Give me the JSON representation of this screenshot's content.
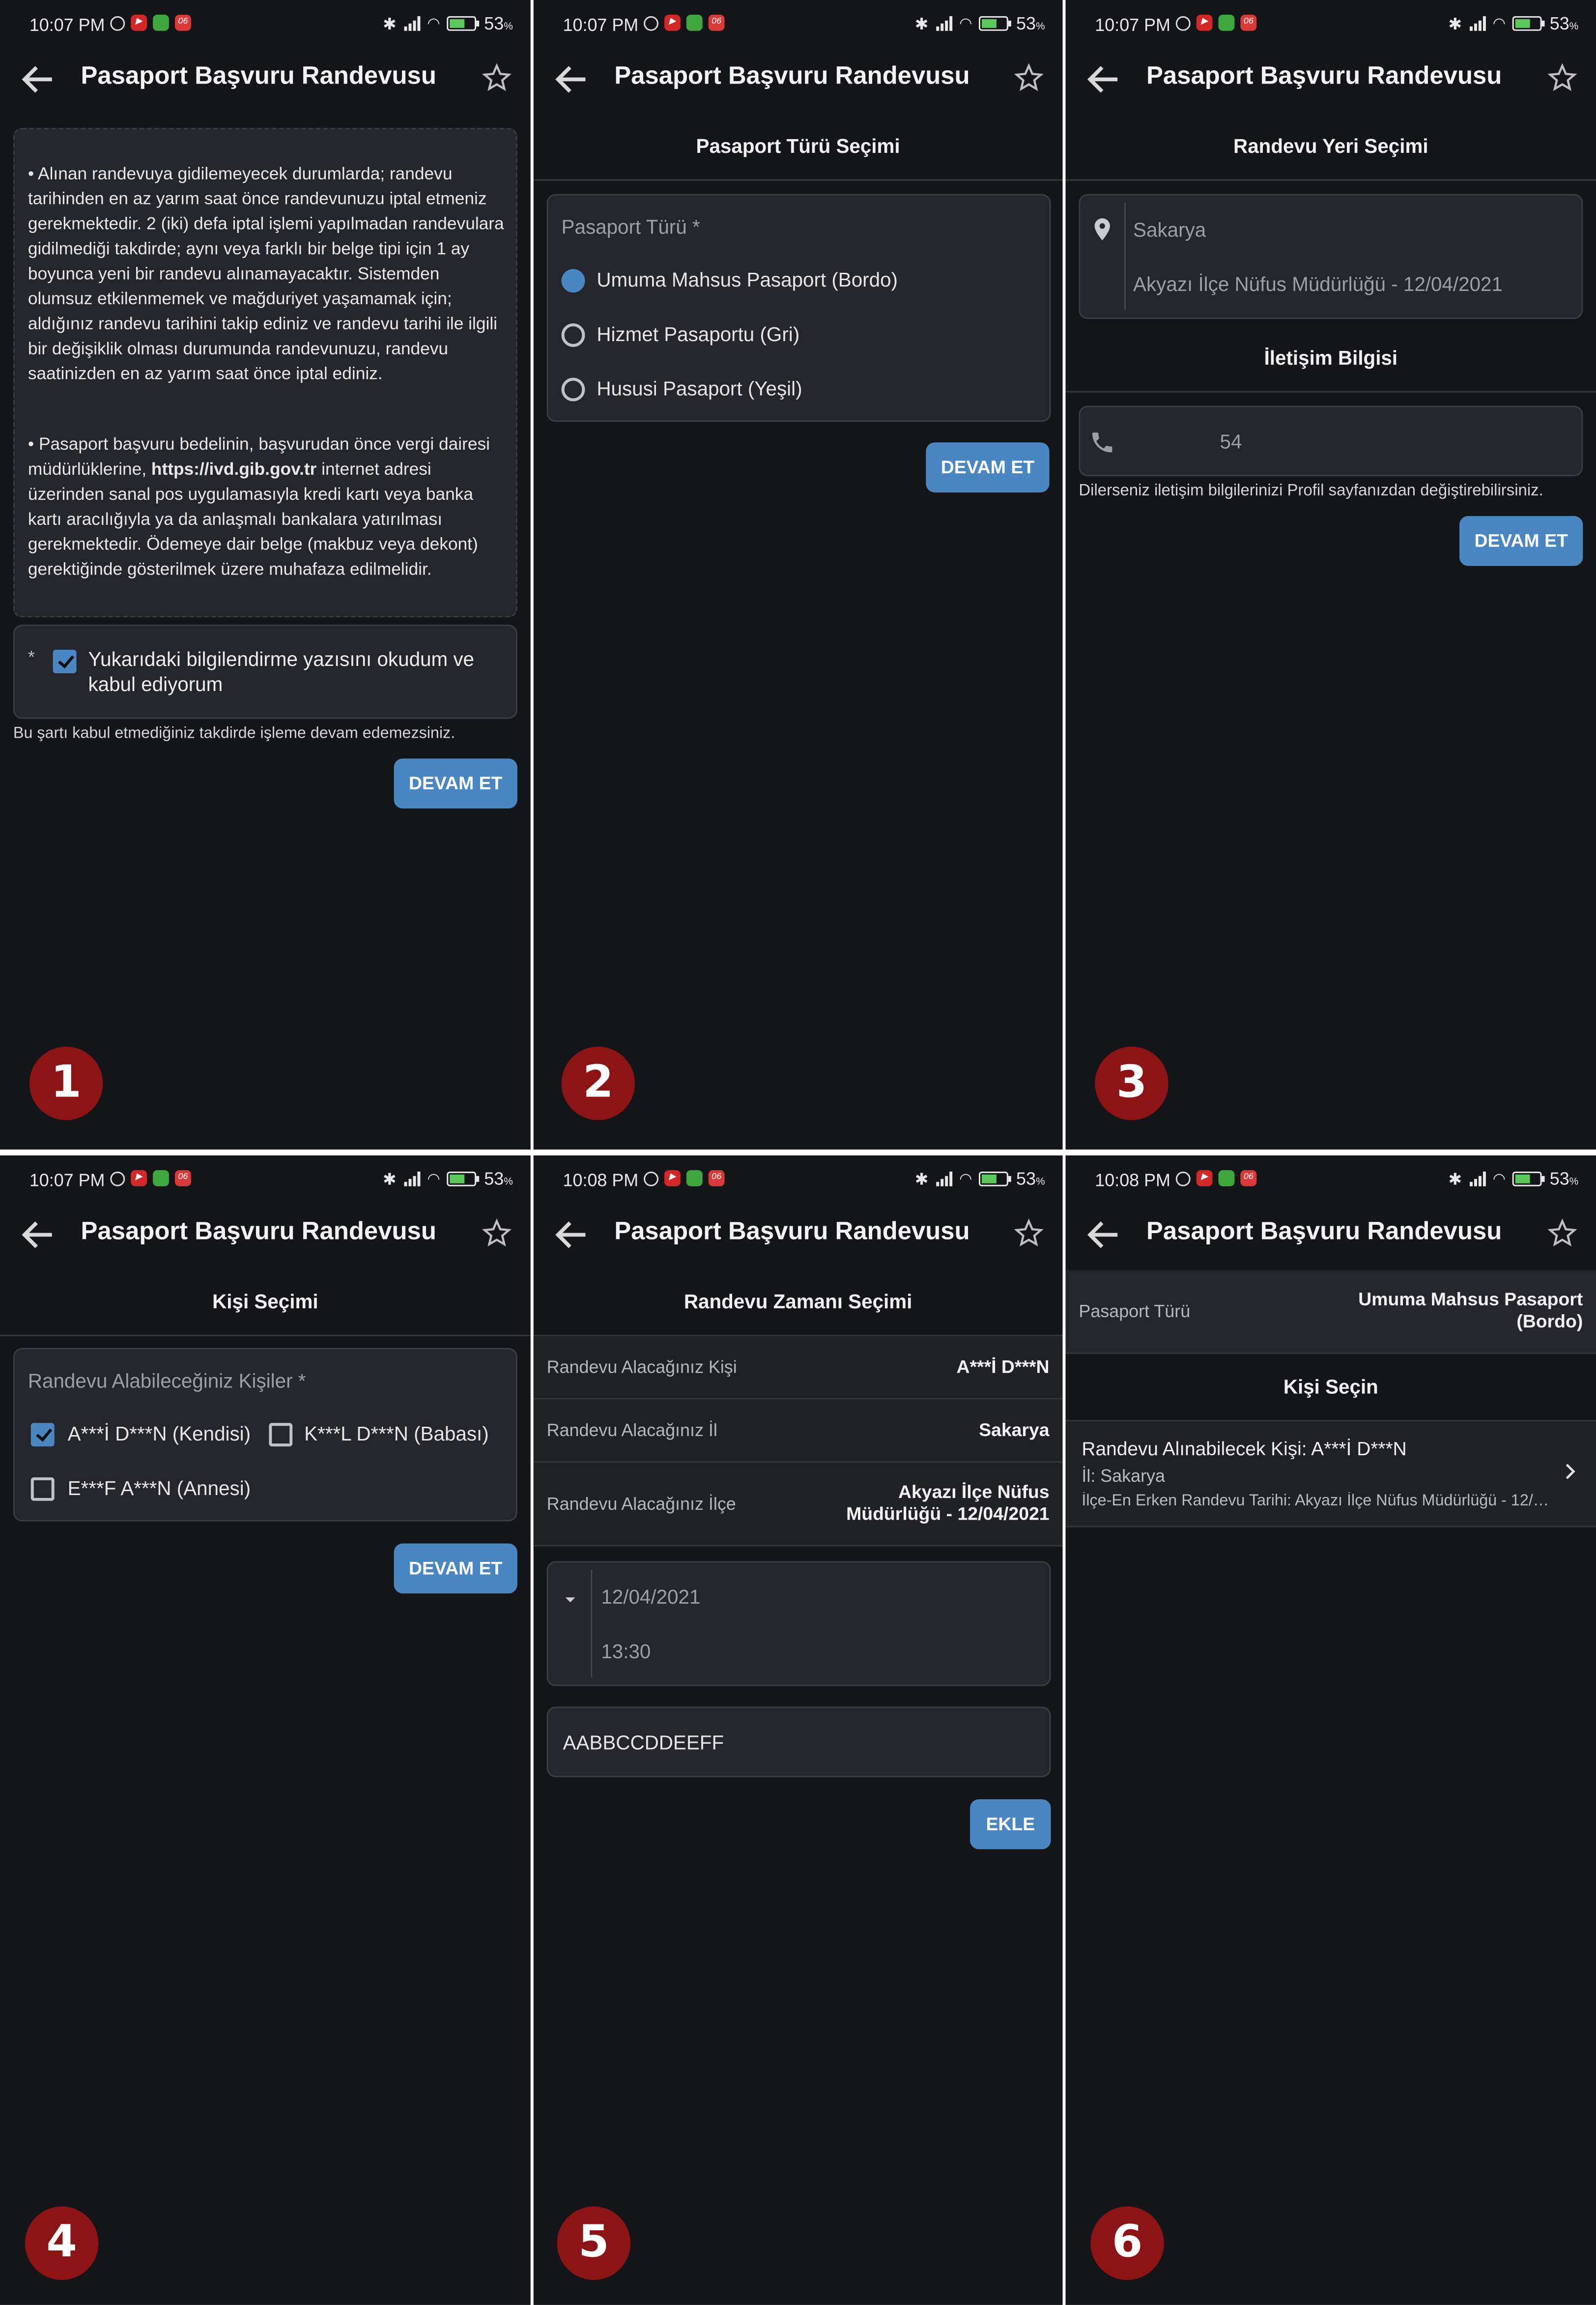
{
  "status_bar": {
    "times": [
      "10:07 PM",
      "10:07 PM",
      "10:07 PM",
      "10:07 PM",
      "10:08 PM",
      "10:08 PM"
    ],
    "battery": "53",
    "battery_unit": "%",
    "notif_label": "06"
  },
  "toolbar": {
    "title": "Pasaport Başvuru Randevusu"
  },
  "badges": [
    "1",
    "2",
    "3",
    "4",
    "5",
    "6"
  ],
  "screen1": {
    "para1": "• Alınan randevuya gidilemeyecek durumlarda; randevu tarihinden en az yarım saat önce randevunuzu iptal etmeniz gerekmektedir. 2 (iki) defa iptal işlemi yapılmadan randevulara gidilmediği takdirde; aynı veya farklı bir belge tipi için 1 ay boyunca yeni bir randevu alınamayacaktır. Sistemden olumsuz etkilenmemek ve mağduriyet yaşamamak için; aldığınız randevu tarihini takip ediniz ve randevu tarihi ile ilgili bir değişiklik olması durumunda randevunuzu, randevu saatinizden en az yarım saat önce iptal ediniz.",
    "para2_before": "• Pasaport başvuru bedelinin, başvurudan önce vergi dairesi müdürlüklerine, ",
    "para2_link": "https://ivd.gib.gov.tr",
    "para2_after": " internet adresi üzerinden sanal pos uygulamasıyla kredi kartı veya banka kartı aracılığıyla ya da anlaşmalı bankalara yatırılması gerekmektedir. Ödemeye dair belge (makbuz veya dekont) gerektiğinde gösterilmek üzere muhafaza edilmelidir.",
    "required_mark": "*",
    "checkbox_label": "Yukarıdaki bilgilendirme yazısını okudum ve kabul ediyorum",
    "warning": "Bu şartı kabul etmediğiniz takdirde işleme devam edemezsiniz.",
    "button": "DEVAM ET"
  },
  "screen2": {
    "header": "Pasaport Türü Seçimi",
    "field_label": "Pasaport Türü *",
    "options": [
      "Umuma Mahsus Pasaport (Bordo)",
      "Hizmet Pasaportu (Gri)",
      "Hususi Pasaport (Yeşil)"
    ],
    "button": "DEVAM ET"
  },
  "screen3": {
    "header": "Randevu Yeri Seçimi",
    "city": "Sakarya",
    "office": "Akyazı İlçe Nüfus Müdürlüğü - 12/04/2021",
    "contact_header": "İletişim Bilgisi",
    "phone": "54",
    "hint": "Dilerseniz iletişim bilgilerinizi Profil sayfanızdan değiştirebilirsiniz.",
    "button": "DEVAM ET"
  },
  "screen4": {
    "header": "Kişi Seçimi",
    "field_label": "Randevu Alabileceğiniz Kişiler *",
    "persons": [
      "A***İ D***N (Kendisi)",
      "K***L D***N (Babası)",
      "E***F A***N (Annesi)"
    ],
    "button": "DEVAM ET"
  },
  "screen5": {
    "header": "Randevu Zamanı Seçimi",
    "rows": [
      {
        "label": "Randevu Alacağınız Kişi",
        "value": "A***İ D***N"
      },
      {
        "label": "Randevu Alacağınız İl",
        "value": "Sakarya"
      },
      {
        "label": "Randevu Alacağınız İlçe",
        "value": "Akyazı İlçe Nüfus Müdürlüğü - 12/04/2021"
      }
    ],
    "date": "12/04/2021",
    "time": "13:30",
    "code": "AABBCCDDEEFF",
    "button": "EKLE"
  },
  "screen6": {
    "type_label": "Pasaport Türü",
    "type_value": "Umuma Mahsus Pasaport (Bordo)",
    "header": "Kişi Seçin",
    "item_title": "Randevu Alınabilecek Kişi: A***İ D***N",
    "item_city": "İl: Sakarya",
    "item_date": "İlçe-En Erken Randevu Tarihi: Akyazı İlçe Nüfus Müdürlüğü - 12/…"
  },
  "colors": {
    "background": "#141518",
    "card": "#24262b",
    "accent": "#4a86c2",
    "badge": "#8c1414"
  }
}
